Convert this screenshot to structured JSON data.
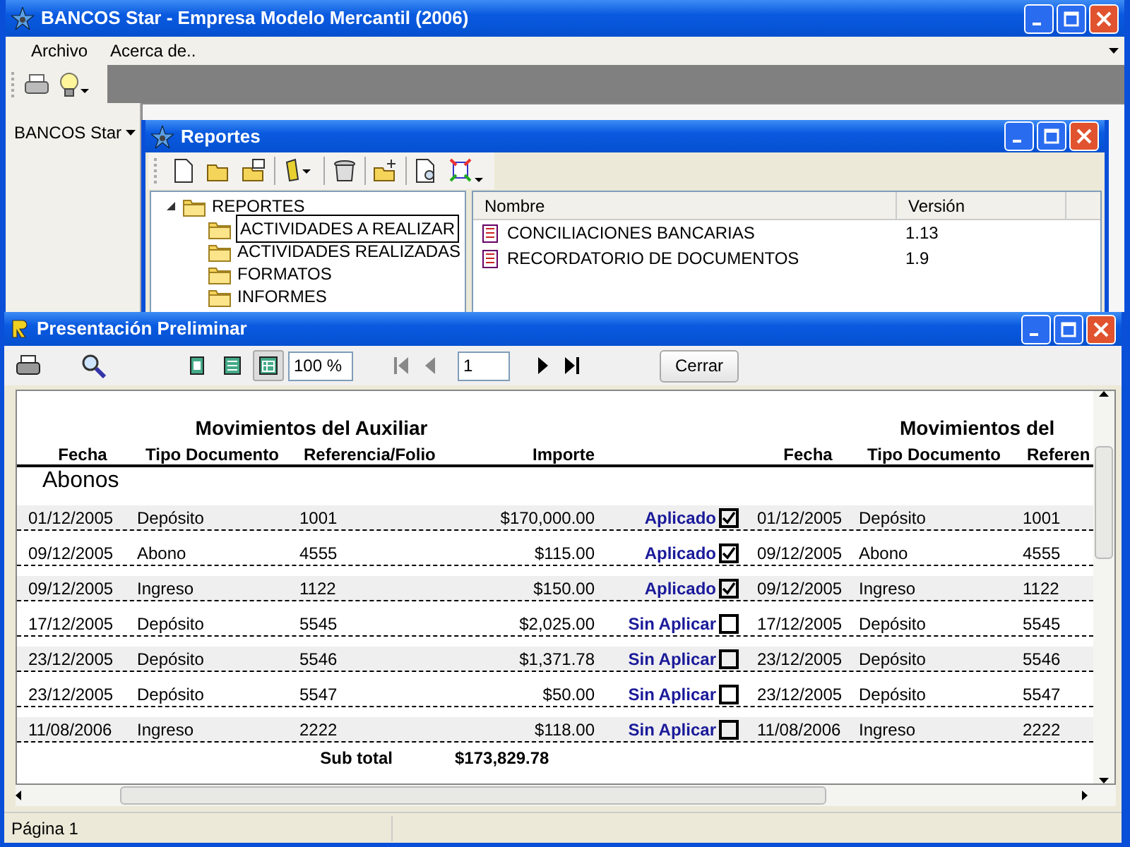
{
  "window": {
    "title": "BANCOS Star - Empresa Modelo Mercantil (2006)"
  },
  "menu": [
    {
      "label": "Archivo"
    },
    {
      "label": "Acerca de.."
    }
  ],
  "side_panel": {
    "label": "BANCOS Star"
  },
  "reportes": {
    "title": "Reportes",
    "tree": {
      "label": "REPORTES",
      "expanded": true,
      "children": [
        {
          "label": "ACTIVIDADES A REALIZAR",
          "selected": true
        },
        {
          "label": "ACTIVIDADES REALIZADAS",
          "selected": false
        },
        {
          "label": "FORMATOS",
          "selected": false
        },
        {
          "label": "INFORMES",
          "selected": false
        }
      ]
    },
    "columns": [
      "Nombre",
      "Versión"
    ],
    "rows": [
      {
        "name": "CONCILIACIONES BANCARIAS",
        "version": "1.13"
      },
      {
        "name": "RECORDATORIO DE DOCUMENTOS",
        "version": "1.9"
      }
    ]
  },
  "preview": {
    "title": "Presentación Preliminar",
    "zoom": "100 %",
    "page": "1",
    "close_button": "Cerrar",
    "view_modes": [
      {
        "selected": false
      },
      {
        "selected": false
      },
      {
        "selected": true
      }
    ],
    "report": {
      "title": "Movimientos del Auxiliar",
      "title_repeat": "Movimientos del",
      "columns": [
        "Fecha",
        "Tipo Documento",
        "Referencia/Folio",
        "Importe"
      ],
      "columns_repeat": [
        "Fecha",
        "Tipo Documento",
        "Referen"
      ],
      "group": "Abonos",
      "rows": [
        {
          "fecha": "01/12/2005",
          "tipo": "Depósito",
          "referencia": "1001",
          "importe": "$170,000.00",
          "status": "Aplicado",
          "checked": true
        },
        {
          "fecha": "09/12/2005",
          "tipo": "Abono",
          "referencia": "4555",
          "importe": "$115.00",
          "status": "Aplicado",
          "checked": true
        },
        {
          "fecha": "09/12/2005",
          "tipo": "Ingreso",
          "referencia": "1122",
          "importe": "$150.00",
          "status": "Aplicado",
          "checked": true
        },
        {
          "fecha": "17/12/2005",
          "tipo": "Depósito",
          "referencia": "5545",
          "importe": "$2,025.00",
          "status": "Sin Aplicar",
          "checked": false
        },
        {
          "fecha": "23/12/2005",
          "tipo": "Depósito",
          "referencia": "5546",
          "importe": "$1,371.78",
          "status": "Sin Aplicar",
          "checked": false
        },
        {
          "fecha": "23/12/2005",
          "tipo": "Depósito",
          "referencia": "5547",
          "importe": "$50.00",
          "status": "Sin Aplicar",
          "checked": false
        },
        {
          "fecha": "11/08/2006",
          "tipo": "Ingreso",
          "referencia": "2222",
          "importe": "$118.00",
          "status": "Sin Aplicar",
          "checked": false
        }
      ],
      "rows_repeat": [
        {
          "fecha": "01/12/2005",
          "tipo": "Depósito",
          "referencia": "1001"
        },
        {
          "fecha": "09/12/2005",
          "tipo": "Abono",
          "referencia": "4555"
        },
        {
          "fecha": "09/12/2005",
          "tipo": "Ingreso",
          "referencia": "1122"
        },
        {
          "fecha": "17/12/2005",
          "tipo": "Depósito",
          "referencia": "5545"
        },
        {
          "fecha": "23/12/2005",
          "tipo": "Depósito",
          "referencia": "5546"
        },
        {
          "fecha": "23/12/2005",
          "tipo": "Depósito",
          "referencia": "5547"
        },
        {
          "fecha": "11/08/2006",
          "tipo": "Ingreso",
          "referencia": "2222"
        }
      ],
      "subtotal": {
        "label": "Sub total",
        "value": "$173,829.78"
      }
    },
    "status_bar": "Página 1"
  }
}
